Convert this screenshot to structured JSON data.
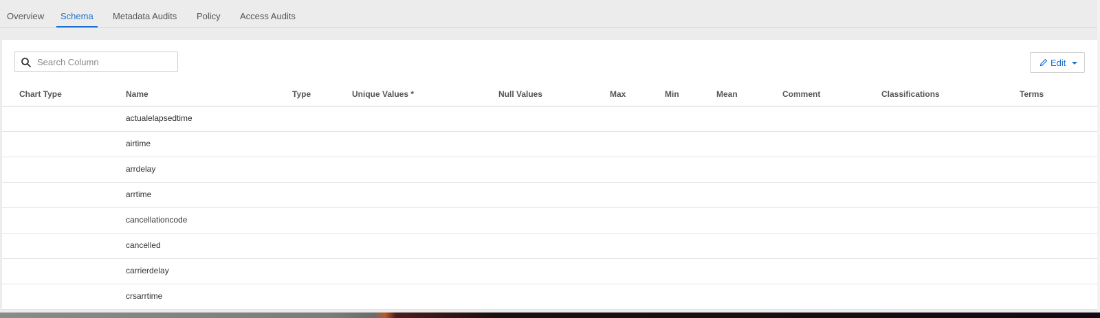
{
  "tabs": [
    {
      "label": "Overview",
      "active": false
    },
    {
      "label": "Schema",
      "active": true
    },
    {
      "label": "Metadata Audits",
      "active": false
    },
    {
      "label": "Policy",
      "active": false
    },
    {
      "label": "Access Audits",
      "active": false
    }
  ],
  "search": {
    "placeholder": "Search Column",
    "value": ""
  },
  "edit_button": {
    "label": "Edit"
  },
  "table": {
    "columns": [
      "Chart Type",
      "Name",
      "Type",
      "Unique Values *",
      "Null Values",
      "Max",
      "Min",
      "Mean",
      "Comment",
      "Classifications",
      "Terms"
    ],
    "rows": [
      {
        "name": "actualelapsedtime"
      },
      {
        "name": "airtime"
      },
      {
        "name": "arrdelay"
      },
      {
        "name": "arrtime"
      },
      {
        "name": "cancellationcode"
      },
      {
        "name": "cancelled"
      },
      {
        "name": "carrierdelay"
      },
      {
        "name": "crsarrtime"
      }
    ]
  },
  "colors": {
    "accent": "#1a6fd0",
    "background": "#ececec",
    "panel": "#ffffff"
  }
}
